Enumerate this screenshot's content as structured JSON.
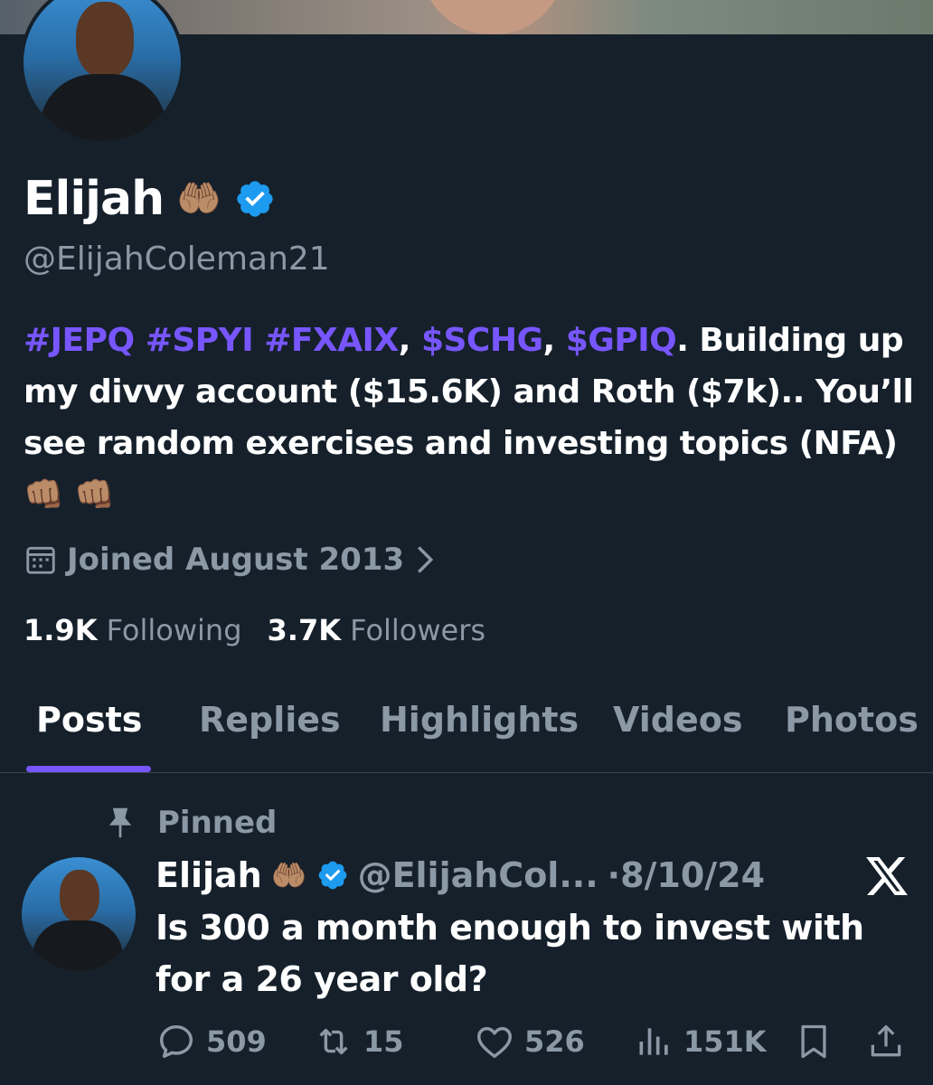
{
  "profile": {
    "name": "Elijah",
    "name_emoji": "🤲🏽",
    "handle": "@ElijahColeman21",
    "bio": {
      "tag1": "#JEPQ",
      "tag2": "#SPYI",
      "tag3": "#FXAIX",
      "sep1": ", ",
      "tag4": "$SCHG",
      "sep2": ", ",
      "tag5": "$GPIQ",
      "text": ". Building up my divvy account ($15.6K) and Roth ($7k).. You’ll see random exercises and investing topics (NFA)",
      "emoji": "👊🏽 👊🏽"
    },
    "joined": "Joined August 2013",
    "following_count": "1.9K",
    "following_label": "Following",
    "followers_count": "3.7K",
    "followers_label": "Followers"
  },
  "tabs": [
    {
      "label": "Posts"
    },
    {
      "label": "Replies"
    },
    {
      "label": "Highlights"
    },
    {
      "label": "Videos"
    },
    {
      "label": "Photos"
    }
  ],
  "post": {
    "pinned_label": "Pinned",
    "author_name": "Elijah",
    "author_emoji": "🤲🏽",
    "author_handle": "@ElijahCol...",
    "date": "·8/10/24",
    "text": "Is 300 a month enough to invest with for a 26 year old?",
    "replies": "509",
    "reposts": "15",
    "likes": "526",
    "views": "151K"
  },
  "colors": {
    "background": "#15202b",
    "accent": "#7856ff",
    "verified": "#1d9bf0",
    "muted": "#8b98a5"
  },
  "icons": [
    "calendar-icon",
    "chevron-right-icon",
    "verified-badge-icon",
    "pin-icon",
    "x-logo-icon",
    "reply-icon",
    "repost-icon",
    "like-icon",
    "views-icon",
    "bookmark-icon",
    "share-icon"
  ]
}
